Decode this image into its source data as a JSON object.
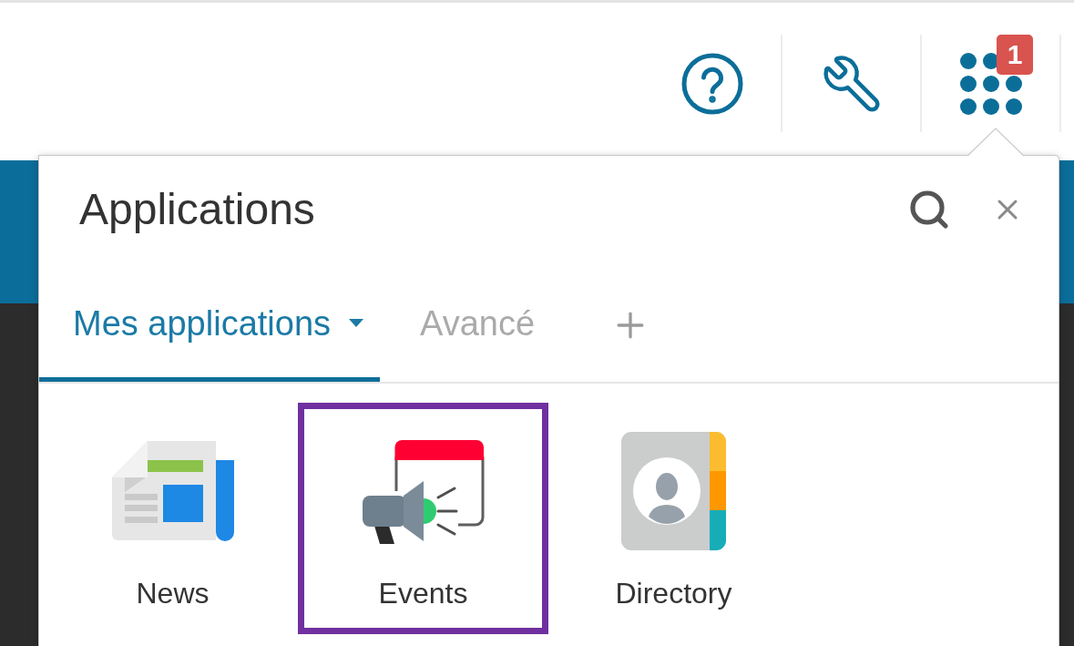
{
  "toolbar": {
    "buttons": [
      {
        "kind": "help"
      },
      {
        "kind": "tools"
      },
      {
        "kind": "apps",
        "badge": "1"
      }
    ]
  },
  "panel": {
    "title": "Applications",
    "tabs": [
      {
        "label": "Mes applications",
        "selected": true,
        "menu": true
      },
      {
        "label": "Avancé",
        "selected": false,
        "menu": false
      }
    ],
    "apps": [
      {
        "label": "News",
        "kind": "news",
        "highlighted": false
      },
      {
        "label": "Events",
        "kind": "events",
        "highlighted": true
      },
      {
        "label": "Directory",
        "kind": "directory",
        "highlighted": false
      }
    ]
  }
}
